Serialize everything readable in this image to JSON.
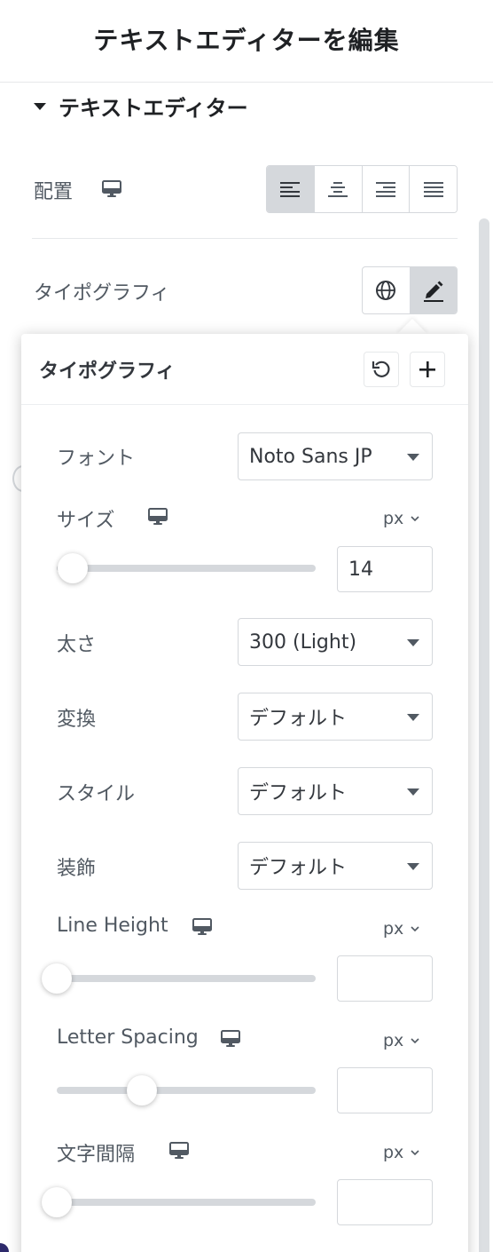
{
  "header": {
    "title": "テキストエディターを編集"
  },
  "section": {
    "title": "テキストエディター"
  },
  "alignment": {
    "label": "配置",
    "options": [
      "left",
      "center",
      "right",
      "justify"
    ],
    "active": "left"
  },
  "typography": {
    "label": "タイポグラフィ"
  },
  "popover": {
    "title": "タイポグラフィ",
    "font": {
      "label": "フォント",
      "value": "Noto Sans JP"
    },
    "size": {
      "label": "サイズ",
      "unit": "px",
      "value": "14",
      "level": 0.06
    },
    "weight": {
      "label": "太さ",
      "value": "300 (Light)"
    },
    "transform": {
      "label": "変換",
      "value": "デフォルト"
    },
    "style": {
      "label": "スタイル",
      "value": "デフォルト"
    },
    "decoration": {
      "label": "装飾",
      "value": "デフォルト"
    },
    "line_height": {
      "label": "Line Height",
      "unit": "px",
      "value": "",
      "level": 0.0
    },
    "letter_spacing": {
      "label": "Letter Spacing",
      "unit": "px",
      "value": "",
      "level": 0.33
    },
    "word_spacing": {
      "label": "文字間隔",
      "unit": "px",
      "value": "",
      "level": 0.0
    }
  },
  "colors": {
    "accent_bg": "#d5d8dc",
    "text": "#33373d",
    "muted": "#515962"
  }
}
